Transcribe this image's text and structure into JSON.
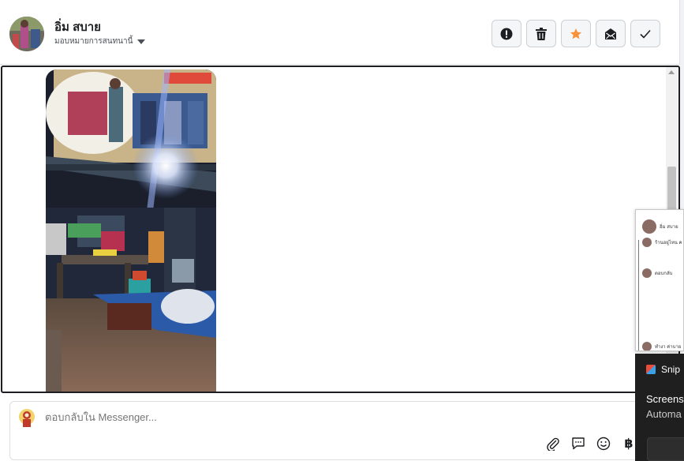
{
  "header": {
    "contact_name": "อิ่ม สบาย",
    "assign_label": "มอบหมายการสนทนานี้",
    "actions": [
      {
        "icon": "alert-icon",
        "label": "Mark as spam"
      },
      {
        "icon": "trash-icon",
        "label": "Delete"
      },
      {
        "icon": "star-icon",
        "label": "Star"
      },
      {
        "icon": "mark-unread-icon",
        "label": "Mark as unread"
      },
      {
        "icon": "check-icon",
        "label": "Mark as done"
      }
    ],
    "star_color": "#f7923a"
  },
  "thread": {
    "attachment": "photo"
  },
  "composer": {
    "placeholder": "ตอบกลับใน Messenger...",
    "tools": [
      "paperclip-icon",
      "chat-bubble-icon",
      "emoji-icon",
      "baht-icon"
    ],
    "baht_symbol": "฿"
  },
  "preview_window": {
    "name": "อิ่ม สบาย",
    "messages": [
      "ร้านอยู่ไหน ค",
      "ตอบกลับ",
      "ทำงา ค่าบาย"
    ]
  },
  "snip_toast": {
    "app": "Snip",
    "line1": "Screens",
    "line2": "Automa"
  }
}
